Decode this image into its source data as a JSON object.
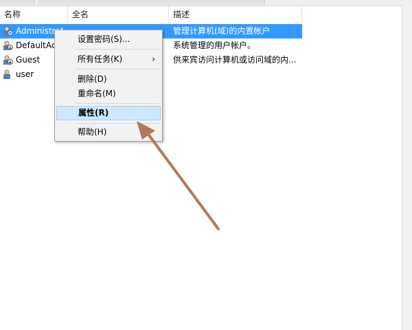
{
  "columns": [
    {
      "label": "名称"
    },
    {
      "label": "全名"
    },
    {
      "label": "描述"
    }
  ],
  "users": [
    {
      "name": "Administrator",
      "description": "管理计算机(域)的内置帐户",
      "selected": true
    },
    {
      "name": "DefaultAccount",
      "description": "系统管理的用户帐户。",
      "selected": false
    },
    {
      "name": "Guest",
      "description": "供来宾访问计算机或访问域的内...",
      "selected": false
    },
    {
      "name": "user",
      "description": "",
      "selected": false
    }
  ],
  "context_menu": {
    "items": [
      {
        "label": "设置密码(S)..."
      },
      {
        "label": "所有任务(K)",
        "submenu_glyph": "›"
      },
      {
        "label": "删除(D)"
      },
      {
        "label": "重命名(M)"
      },
      {
        "label": "属性(R)",
        "highlighted": true
      },
      {
        "label": "帮助(H)"
      }
    ]
  },
  "icons": {
    "user_icon": "user-account-icon",
    "submenu_arrow": "chevron-right-icon"
  },
  "colors": {
    "selection": "#3399ff",
    "menu_background": "#f2f2f2",
    "menu_highlight": "#cce8ff",
    "annotation_arrow": "#b07a5a"
  }
}
